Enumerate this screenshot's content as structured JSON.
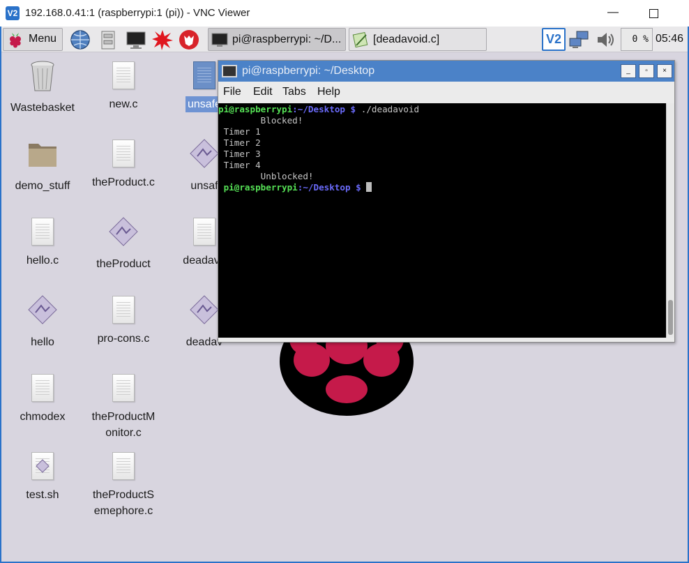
{
  "vnc": {
    "app_icon": "V2",
    "title": "192.168.0.41:1 (raspberrypi:1 (pi)) - VNC Viewer",
    "minimize": "—"
  },
  "taskbar": {
    "menu_label": "Menu",
    "launchers": [
      "globe-icon",
      "file-manager-icon",
      "monitor-icon",
      "starburst-icon",
      "wolfram-icon"
    ],
    "tasks": [
      {
        "label": "pi@raspberrypi: ~/D...",
        "icon": "terminal-icon",
        "active": true
      },
      {
        "label": "[deadavoid.c]",
        "icon": "text-editor-icon",
        "active": false
      }
    ],
    "tray": {
      "vnc_label": "V2",
      "cpu": "0 %",
      "clock": "05:46"
    }
  },
  "desktop_icons": {
    "col1": [
      "Wastebasket",
      "demo_stuff",
      "hello.c",
      "hello",
      "chmodex",
      "test.sh"
    ],
    "col2": [
      "new.c",
      "theProduct.c",
      "theProduct",
      "pro-cons.c",
      "theProductM onitor.c",
      "theProductS emephore.c"
    ],
    "col3": [
      "unsafe",
      "unsaf",
      "deadavo",
      "deadav"
    ]
  },
  "terminal": {
    "title": "pi@raspberrypi: ~/Desktop",
    "controls": [
      "_",
      "▫",
      "×"
    ],
    "menu": [
      "File",
      "Edit",
      "Tabs",
      "Help"
    ],
    "prompt_user": "pi@raspberrypi",
    "prompt_path": ":~/Desktop $",
    "command": " ./deadavoid",
    "output": [
      "        Blocked!",
      " Timer 1",
      " Timer 2",
      " Timer 3",
      " Timer 4",
      "        Unblocked!"
    ],
    "prompt2_user": " pi@raspberrypi",
    "prompt2_path": ":~/Desktop $"
  },
  "colors": {
    "desktop_bg": "#d8d5df",
    "terminal_title_bg": "#4b82c8",
    "prompt_user": "#55e055",
    "prompt_path": "#6a6afa",
    "raspberry": "#c51a4a"
  }
}
